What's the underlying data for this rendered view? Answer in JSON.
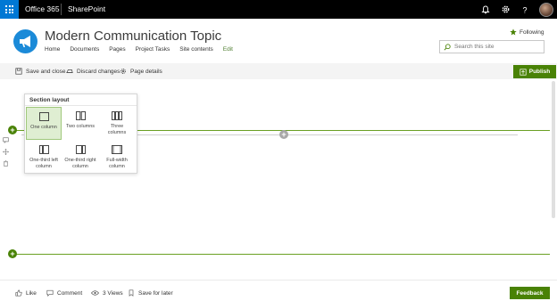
{
  "suitebar": {
    "brand": "Office 365",
    "app": "SharePoint",
    "icons": [
      "bell-icon",
      "gear-icon",
      "help-icon"
    ]
  },
  "site": {
    "title": "Modern Communication Topic",
    "nav": [
      "Home",
      "Documents",
      "Pages",
      "Project Tasks",
      "Site contents",
      "Edit"
    ],
    "following_label": "Following",
    "search_placeholder": "Search this site"
  },
  "commandbar": {
    "save_label": "Save and close",
    "discard_label": "Discard changes",
    "details_label": "Page details",
    "publish_label": "Publish"
  },
  "section_layout": {
    "title": "Section layout",
    "options": [
      {
        "label": "One column",
        "selected": true
      },
      {
        "label": "Two columns",
        "selected": false
      },
      {
        "label": "Three columns",
        "selected": false
      },
      {
        "label": "One-third left column",
        "selected": false
      },
      {
        "label": "One-third right column",
        "selected": false
      },
      {
        "label": "Full-width column",
        "selected": false
      }
    ]
  },
  "footer": {
    "like_label": "Like",
    "comment_label": "Comment",
    "views_label": "3 Views",
    "save_label": "Save for later",
    "feedback_label": "Feedback"
  },
  "colors": {
    "accent_green": "#498205",
    "line_green": "#6aa023",
    "waffle_blue": "#0078d4",
    "logo_blue": "#1b8ad8"
  }
}
